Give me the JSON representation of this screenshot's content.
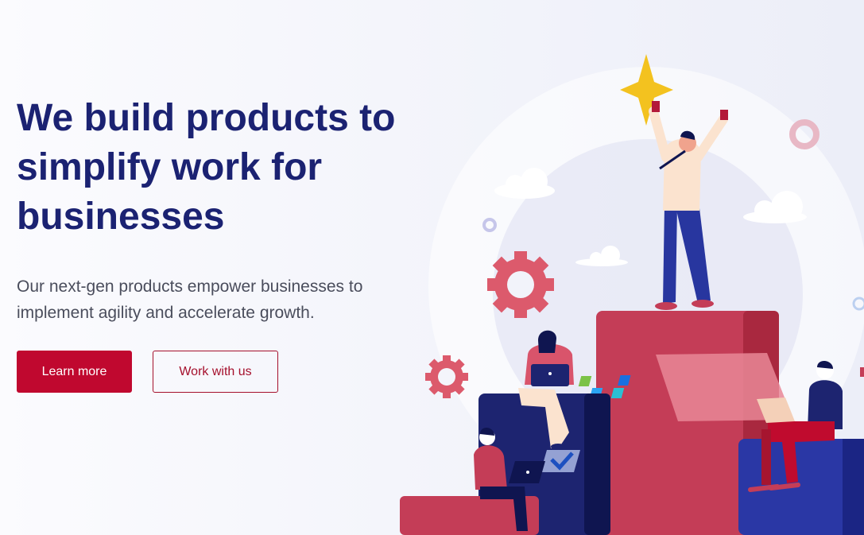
{
  "hero": {
    "headline": "We build products to\nsimplify work for\nbusinesses",
    "subtitle": "Our next-gen products empower businesses to\nimplement agility and accelerate growth."
  },
  "buttons": {
    "learn_more": "Learn more",
    "work_with_us": "Work with us"
  },
  "colors": {
    "heading": "#1b2272",
    "primary": "#c0082f",
    "podium_red": "#c43d57",
    "podium_navy": "#1d2470",
    "podium_blue": "#2a37a5",
    "star": "#f3c21f",
    "gear": "#dc5a6c"
  },
  "illustration": {
    "icons": [
      "star-icon",
      "gear-icon",
      "cloud-icon",
      "ring-icon",
      "checkmark-icon",
      "laptop-icon"
    ]
  }
}
